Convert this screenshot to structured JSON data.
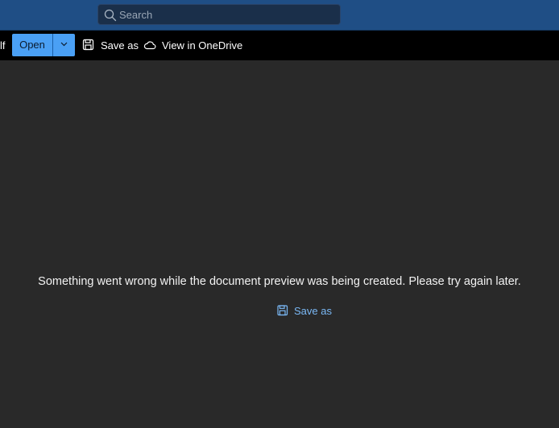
{
  "header": {
    "search": {
      "placeholder": "Search",
      "value": ""
    }
  },
  "toolbar": {
    "filename_tail": "lf",
    "open_label": "Open",
    "save_as_label": "Save as",
    "view_onedrive_label": "View in OneDrive"
  },
  "preview": {
    "error_message": "Something went wrong while the document preview was being created. Please try again later.",
    "save_as_label": "Save as"
  },
  "colors": {
    "header_bg": "#1f4e85",
    "toolbar_bg": "#000000",
    "content_bg": "#292929",
    "accent": "#4aa0f5",
    "link": "#7ab8f5"
  },
  "icons": {
    "search": "search-icon",
    "dropdown": "chevron-down-icon",
    "save": "floppy-disk-icon",
    "cloud": "cloud-icon"
  }
}
